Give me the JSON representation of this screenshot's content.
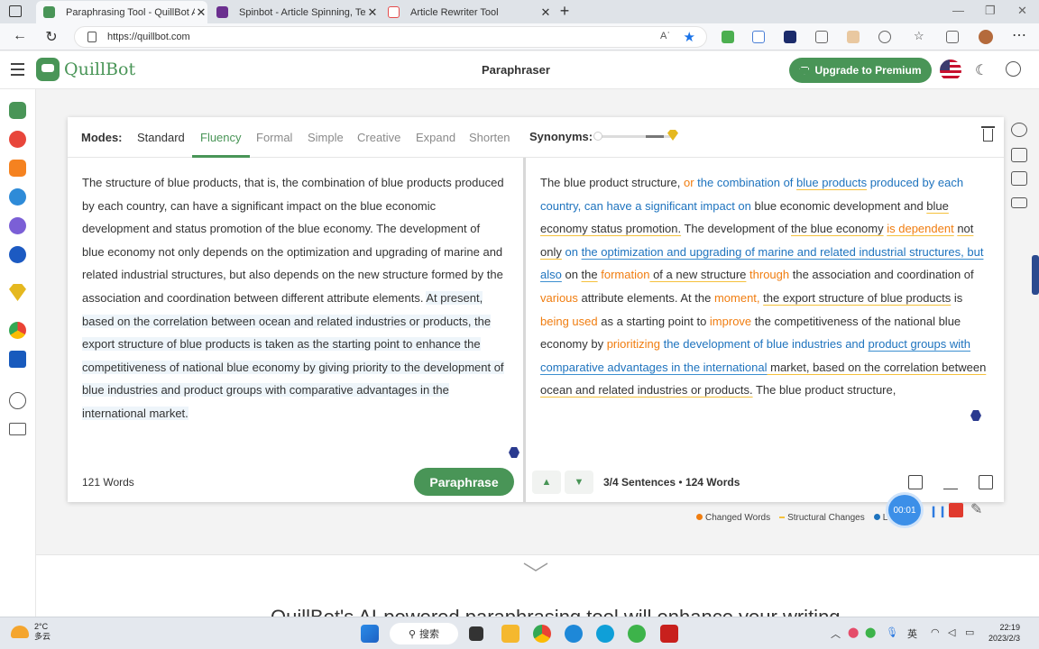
{
  "browser": {
    "tabs": [
      {
        "title": "Paraphrasing Tool - QuillBot AI",
        "favicon_color": "#499557",
        "active": true
      },
      {
        "title": "Spinbot - Article Spinning, Text R",
        "favicon_color": "#6b2f8f",
        "active": false
      },
      {
        "title": "Article Rewriter Tool",
        "favicon_color": "#e54c4c",
        "active": false
      }
    ],
    "url": "https://quillbot.com",
    "read_aloud_label": "Aʾ",
    "extension_badge": "8"
  },
  "header": {
    "logo_text": "QuillBot",
    "page_title": "Paraphraser",
    "upgrade_label": "Upgrade to Premium",
    "brand_color": "#499557"
  },
  "modes": {
    "label": "Modes:",
    "items": [
      "Standard",
      "Fluency",
      "Formal",
      "Simple",
      "Creative",
      "Expand",
      "Shorten"
    ],
    "active": "Fluency"
  },
  "synonyms": {
    "label": "Synonyms:",
    "level": 0.75
  },
  "input": {
    "plain": "The structure of blue products, that is, the combination of blue products produced by each country, can have a significant impact on the blue economic development and status promotion of the blue economy. The development of blue economy not only depends on the optimization and upgrading of marine and related industrial structures, but also depends on the new structure formed by the association and coordination between different attribute elements. ",
    "highlighted": "At present, based on the correlation between ocean and related industries or products, the export structure of blue products is taken as the starting point to enhance the competitiveness of national blue economy by giving priority to the development of blue industries and product groups with comparative advantages in the international market.",
    "word_count": "121 Words"
  },
  "output": {
    "segments": [
      {
        "t": "The blue product structure, ",
        "c": ""
      },
      {
        "t": "or",
        "c": "o"
      },
      {
        "t": " ",
        "c": ""
      },
      {
        "t": "the combination of",
        "c": "b"
      },
      {
        "t": " ",
        "c": ""
      },
      {
        "t": "blue products",
        "c": "b uy"
      },
      {
        "t": " produced by each country, can have a significant impact on",
        "c": "b"
      },
      {
        "t": " blue economic development and ",
        "c": ""
      },
      {
        "t": "blue economy status promotion.",
        "c": "uy"
      },
      {
        "t": " The development of ",
        "c": ""
      },
      {
        "t": "the blue economy",
        "c": "uy"
      },
      {
        "t": " ",
        "c": ""
      },
      {
        "t": "is dependent",
        "c": "o uy"
      },
      {
        "t": " ",
        "c": ""
      },
      {
        "t": "not only",
        "c": "uy"
      },
      {
        "t": " ",
        "c": ""
      },
      {
        "t": "on",
        "c": "b"
      },
      {
        "t": " ",
        "c": ""
      },
      {
        "t": "the optimization and upgrading of marine and related industrial structures, but also",
        "c": "b ub"
      },
      {
        "t": " on ",
        "c": ""
      },
      {
        "t": "the",
        "c": "uy"
      },
      {
        "t": " ",
        "c": ""
      },
      {
        "t": "formation",
        "c": "o"
      },
      {
        "t": " of a new structure",
        "c": "uy"
      },
      {
        "t": " ",
        "c": ""
      },
      {
        "t": "through",
        "c": "o"
      },
      {
        "t": " the association and coordination of ",
        "c": ""
      },
      {
        "t": "various",
        "c": "o"
      },
      {
        "t": " attribute elements. At the ",
        "c": ""
      },
      {
        "t": "moment,",
        "c": "o"
      },
      {
        "t": " ",
        "c": ""
      },
      {
        "t": "the export structure of blue products",
        "c": "uy"
      },
      {
        "t": " is ",
        "c": ""
      },
      {
        "t": "being used",
        "c": "o"
      },
      {
        "t": " as a starting point to ",
        "c": ""
      },
      {
        "t": "improve",
        "c": "o"
      },
      {
        "t": " the competitiveness of the national blue economy by ",
        "c": ""
      },
      {
        "t": "prioritizing",
        "c": "o"
      },
      {
        "t": " ",
        "c": ""
      },
      {
        "t": "the development of blue industries and",
        "c": "b"
      },
      {
        "t": " ",
        "c": ""
      },
      {
        "t": "product groups with comparative advantages in the international",
        "c": "b ub"
      },
      {
        "t": " market, based on the correlation between ocean and related ",
        "c": "uy"
      },
      {
        "t": "industries or products.",
        "c": "uy"
      },
      {
        "t": " The blue product structure,",
        "c": ""
      }
    ],
    "sentences": "3/4 Sentences",
    "words": "124 Words",
    "separator": "•"
  },
  "paraphrase_label": "Paraphrase",
  "legend": {
    "items": [
      {
        "label": "Changed Words",
        "color": "#f07d10",
        "kind": "dot"
      },
      {
        "label": "Structural Changes",
        "color": "#f5c13c",
        "kind": "dash"
      },
      {
        "label": "Lo",
        "color": "#1e73be",
        "kind": "dot"
      }
    ]
  },
  "recorder": {
    "time": "00:01"
  },
  "taskbar": {
    "temp": "2°C",
    "weather": "多云",
    "search": "搜索",
    "ime": "英",
    "time": "22:19",
    "date": "2023/2/3"
  },
  "page_heading_partial": "QuillBot's AI-powered paraphrasing tool will enhance your writing"
}
